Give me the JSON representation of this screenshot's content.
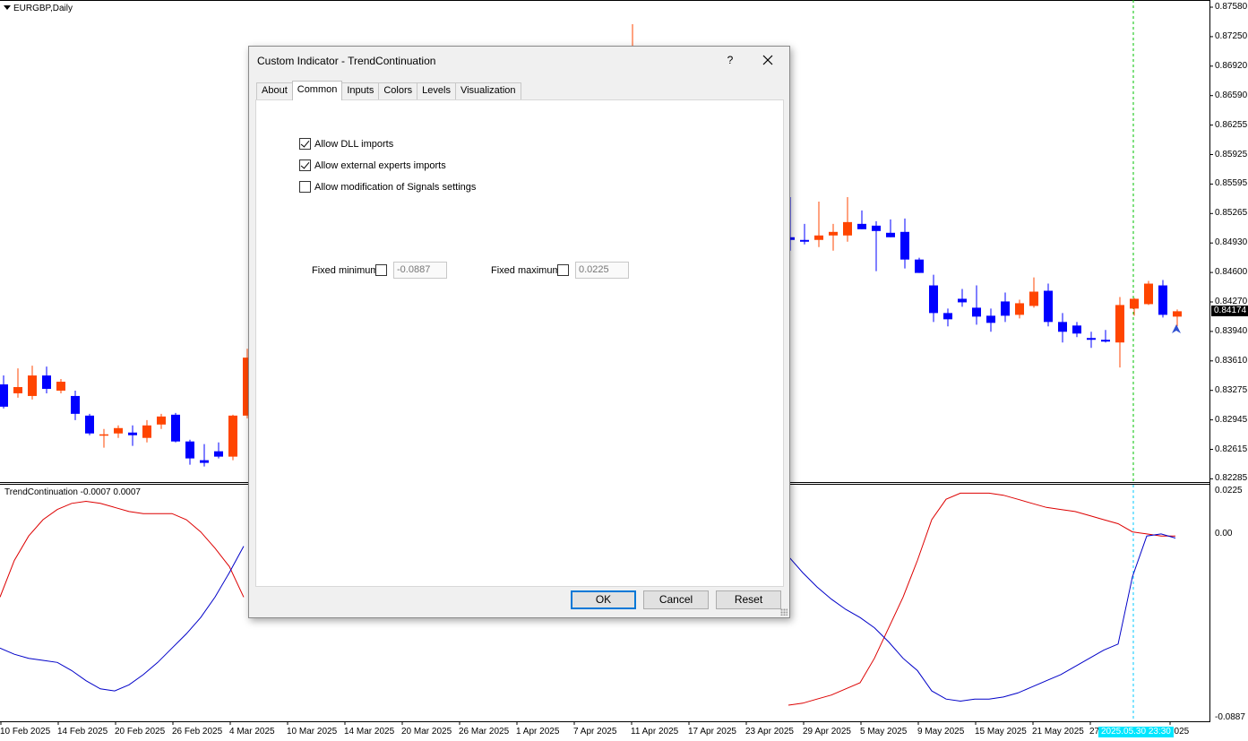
{
  "chart": {
    "symbol_label": "EURGBP,Daily",
    "indicator_label": "TrendContinuation -0.0007 0.0007",
    "current_price": "0.84174",
    "cursor_time": "2025.05.30 23:30",
    "price_labels": [
      "0.87580",
      "0.87250",
      "0.86920",
      "0.86590",
      "0.86255",
      "0.85925",
      "0.85595",
      "0.85265",
      "0.84930",
      "0.84600",
      "0.84270",
      "0.83940",
      "0.83610",
      "0.83275",
      "0.82945",
      "0.82615",
      "0.82285"
    ],
    "indicator_scale_labels": [
      "0.0225",
      "0.00",
      "-0.0887"
    ],
    "date_labels": [
      "10 Feb 2025",
      "14 Feb 2025",
      "20 Feb 2025",
      "26 Feb 2025",
      "4 Mar 2025",
      "10 Mar 2025",
      "14 Mar 2025",
      "20 Mar 2025",
      "26 Mar 2025",
      "1 Apr 2025",
      "7 Apr 2025",
      "11 Apr 2025",
      "17 Apr 2025",
      "23 Apr 2025",
      "29 Apr 2025",
      "5 May 2025",
      "9 May 2025",
      "15 May 2025",
      "21 May 2025",
      "27",
      "2025"
    ],
    "colors": {
      "bull": "#ff4500",
      "bear": "#0000ff",
      "line_red": "#dd0000",
      "line_blue": "#0000c8",
      "grid_vline": "#00c000"
    }
  },
  "chart_data": {
    "type": "candlestick",
    "symbol": "EURGBP",
    "timeframe": "Daily",
    "candles_visible_left": [
      {
        "open": 0.8335,
        "high": 0.8345,
        "low": 0.8308,
        "close": 0.831
      },
      {
        "open": 0.8325,
        "high": 0.8353,
        "low": 0.832,
        "close": 0.8332
      },
      {
        "open": 0.8322,
        "high": 0.8356,
        "low": 0.8318,
        "close": 0.8345
      },
      {
        "open": 0.8345,
        "high": 0.8355,
        "low": 0.8325,
        "close": 0.833
      },
      {
        "open": 0.8328,
        "high": 0.8341,
        "low": 0.8325,
        "close": 0.8338
      },
      {
        "open": 0.8322,
        "high": 0.8328,
        "low": 0.8295,
        "close": 0.8302
      },
      {
        "open": 0.83,
        "high": 0.8302,
        "low": 0.8278,
        "close": 0.828
      },
      {
        "open": 0.8278,
        "high": 0.8285,
        "low": 0.8264,
        "close": 0.8279
      },
      {
        "open": 0.828,
        "high": 0.8289,
        "low": 0.8275,
        "close": 0.8286
      },
      {
        "open": 0.8281,
        "high": 0.8289,
        "low": 0.8266,
        "close": 0.8278
      },
      {
        "open": 0.8275,
        "high": 0.8295,
        "low": 0.827,
        "close": 0.8289
      },
      {
        "open": 0.829,
        "high": 0.8302,
        "low": 0.8285,
        "close": 0.8299
      },
      {
        "open": 0.8301,
        "high": 0.8303,
        "low": 0.827,
        "close": 0.8271
      },
      {
        "open": 0.8271,
        "high": 0.8273,
        "low": 0.8245,
        "close": 0.8252
      },
      {
        "open": 0.825,
        "high": 0.8268,
        "low": 0.8243,
        "close": 0.8247
      },
      {
        "open": 0.826,
        "high": 0.827,
        "low": 0.8252,
        "close": 0.8254
      },
      {
        "open": 0.8254,
        "high": 0.8301,
        "low": 0.825,
        "close": 0.83
      },
      {
        "open": 0.83,
        "high": 0.8375,
        "low": 0.8297,
        "close": 0.8365
      }
    ],
    "candles_visible_right": [
      {
        "open": 0.85,
        "high": 0.8545,
        "low": 0.8485,
        "close": 0.8497
      },
      {
        "open": 0.8497,
        "high": 0.8515,
        "low": 0.8492,
        "close": 0.8495
      },
      {
        "open": 0.8497,
        "high": 0.854,
        "low": 0.8489,
        "close": 0.8502
      },
      {
        "open": 0.8502,
        "high": 0.8515,
        "low": 0.8485,
        "close": 0.8506
      },
      {
        "open": 0.8502,
        "high": 0.8545,
        "low": 0.8495,
        "close": 0.8517
      },
      {
        "open": 0.8515,
        "high": 0.853,
        "low": 0.8509,
        "close": 0.8509
      },
      {
        "open": 0.8513,
        "high": 0.8518,
        "low": 0.8462,
        "close": 0.8507
      },
      {
        "open": 0.8505,
        "high": 0.852,
        "low": 0.85,
        "close": 0.85
      },
      {
        "open": 0.8506,
        "high": 0.8521,
        "low": 0.8465,
        "close": 0.8475
      },
      {
        "open": 0.8475,
        "high": 0.8477,
        "low": 0.846,
        "close": 0.846
      },
      {
        "open": 0.8446,
        "high": 0.8458,
        "low": 0.8405,
        "close": 0.8415
      },
      {
        "open": 0.8415,
        "high": 0.842,
        "low": 0.84,
        "close": 0.8408
      },
      {
        "open": 0.8431,
        "high": 0.8442,
        "low": 0.8422,
        "close": 0.8427
      },
      {
        "open": 0.8421,
        "high": 0.8446,
        "low": 0.8402,
        "close": 0.8411
      },
      {
        "open": 0.8412,
        "high": 0.842,
        "low": 0.8394,
        "close": 0.8404
      },
      {
        "open": 0.8428,
        "high": 0.8438,
        "low": 0.8405,
        "close": 0.8412
      },
      {
        "open": 0.8413,
        "high": 0.843,
        "low": 0.8409,
        "close": 0.8426
      },
      {
        "open": 0.8423,
        "high": 0.8455,
        "low": 0.8421,
        "close": 0.8439
      },
      {
        "open": 0.844,
        "high": 0.8448,
        "low": 0.84,
        "close": 0.8405
      },
      {
        "open": 0.8405,
        "high": 0.8415,
        "low": 0.8382,
        "close": 0.8394
      },
      {
        "open": 0.8401,
        "high": 0.8405,
        "low": 0.8388,
        "close": 0.8392
      },
      {
        "open": 0.8387,
        "high": 0.8394,
        "low": 0.8376,
        "close": 0.8385
      },
      {
        "open": 0.8385,
        "high": 0.8396,
        "low": 0.8382,
        "close": 0.8383
      },
      {
        "open": 0.8382,
        "high": 0.8433,
        "low": 0.8354,
        "close": 0.8424
      },
      {
        "open": 0.842,
        "high": 0.8432,
        "low": 0.8412,
        "close": 0.8431
      },
      {
        "open": 0.8425,
        "high": 0.8451,
        "low": 0.8424,
        "close": 0.8448
      },
      {
        "open": 0.8446,
        "high": 0.8452,
        "low": 0.841,
        "close": 0.8413
      },
      {
        "open": 0.8411,
        "high": 0.8419,
        "low": 0.84,
        "close": 0.8417
      }
    ],
    "indicator_series": [
      {
        "color": "red",
        "values_left": [
          -0.03,
          -0.012,
          0.0,
          0.008,
          0.013,
          0.016,
          0.017,
          0.016,
          0.014,
          0.012,
          0.011,
          0.011,
          0.011,
          0.008,
          0.002,
          -0.006,
          -0.015,
          -0.03
        ]
      },
      {
        "color": "blue",
        "values_left": [
          -0.055,
          -0.058,
          -0.06,
          -0.061,
          -0.062,
          -0.066,
          -0.071,
          -0.075,
          -0.076,
          -0.073,
          -0.068,
          -0.062,
          -0.055,
          -0.048,
          -0.04,
          -0.03,
          -0.018,
          -0.005
        ]
      },
      {
        "color": "red",
        "values_right": [
          -0.083,
          -0.082,
          -0.08,
          -0.078,
          -0.075,
          -0.072,
          -0.06,
          -0.045,
          -0.03,
          -0.012,
          0.008,
          0.018,
          0.021,
          0.021,
          0.021,
          0.02,
          0.018,
          0.016,
          0.014,
          0.013,
          0.012,
          0.01,
          0.008,
          0.006,
          0.002,
          0.001,
          0.0,
          0.0
        ]
      },
      {
        "color": "blue",
        "values_right": [
          -0.01,
          -0.018,
          -0.025,
          -0.031,
          -0.036,
          -0.04,
          -0.045,
          -0.052,
          -0.06,
          -0.066,
          -0.076,
          -0.08,
          -0.081,
          -0.08,
          -0.08,
          -0.079,
          -0.077,
          -0.074,
          -0.071,
          -0.068,
          -0.064,
          -0.06,
          -0.056,
          -0.053,
          -0.02,
          0.0,
          0.001,
          -0.001
        ]
      }
    ],
    "price_range": [
      0.82285,
      0.8758
    ],
    "indicator_range": [
      -0.0887,
      0.0225
    ]
  },
  "dialog": {
    "title": "Custom Indicator - TrendContinuation",
    "help_label": "?",
    "tabs": [
      "About",
      "Common",
      "Inputs",
      "Colors",
      "Levels",
      "Visualization"
    ],
    "active_tab": "Common",
    "checkboxes": [
      {
        "label": "Allow DLL imports",
        "checked": true
      },
      {
        "label": "Allow external experts imports",
        "checked": true
      },
      {
        "label": "Allow modification of Signals settings",
        "checked": false
      }
    ],
    "fixed_minimum": {
      "label": "Fixed minimum",
      "checked": false,
      "value": "-0.0887"
    },
    "fixed_maximum": {
      "label": "Fixed maximum",
      "checked": false,
      "value": "0.0225"
    },
    "buttons": {
      "ok": "OK",
      "cancel": "Cancel",
      "reset": "Reset"
    }
  }
}
